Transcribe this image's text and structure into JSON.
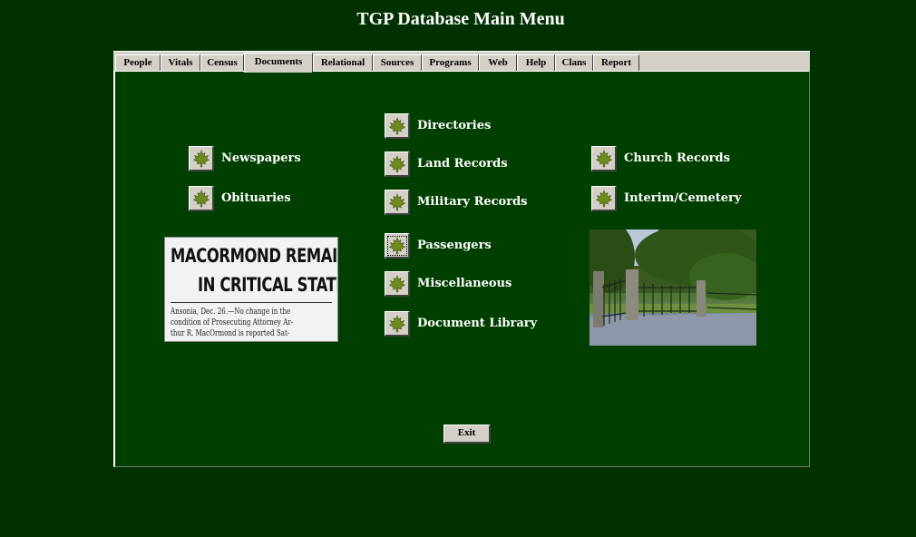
{
  "app": {
    "title": "TGP Database Main Menu"
  },
  "tabs": [
    {
      "label": "People"
    },
    {
      "label": "Vitals"
    },
    {
      "label": "Census"
    },
    {
      "label": "Documents",
      "active": true
    },
    {
      "label": "Relational"
    },
    {
      "label": "Sources"
    },
    {
      "label": "Programs"
    },
    {
      "label": "Web"
    },
    {
      "label": "Help"
    },
    {
      "label": "Clans"
    },
    {
      "label": "Report"
    }
  ],
  "documents": {
    "left": [
      {
        "label": "Newspapers",
        "icon": "maple-leaf-icon"
      },
      {
        "label": "Obituaries",
        "icon": "maple-leaf-icon"
      }
    ],
    "center": [
      {
        "label": "Directories",
        "icon": "maple-leaf-icon"
      },
      {
        "label": "Land Records",
        "icon": "maple-leaf-icon"
      },
      {
        "label": "Military Records",
        "icon": "maple-leaf-icon"
      },
      {
        "label": "Passengers",
        "icon": "maple-leaf-icon",
        "focused": true
      },
      {
        "label": "Miscellaneous",
        "icon": "maple-leaf-icon"
      },
      {
        "label": "Document Library",
        "icon": "maple-leaf-icon"
      }
    ],
    "right": [
      {
        "label": "Church Records",
        "icon": "maple-leaf-icon"
      },
      {
        "label": "Interim/Cemetery",
        "icon": "maple-leaf-icon"
      }
    ],
    "clipping": {
      "headline_line1": "MACORMOND REMAINS",
      "headline_line2": "IN CRITICAL STATE",
      "body_line1": "Ansonia, Dec. 26.—No change in the",
      "body_line2": "condition of Prosecuting Attorney Ar-",
      "body_line3": "thur R. MacOrmond is reported Sat-"
    }
  },
  "footer": {
    "exit_label": "Exit"
  },
  "colors": {
    "background": "#013001",
    "panel": "#013f01",
    "chrome": "#d4d0c8",
    "leaf": "#6f8a1e"
  }
}
